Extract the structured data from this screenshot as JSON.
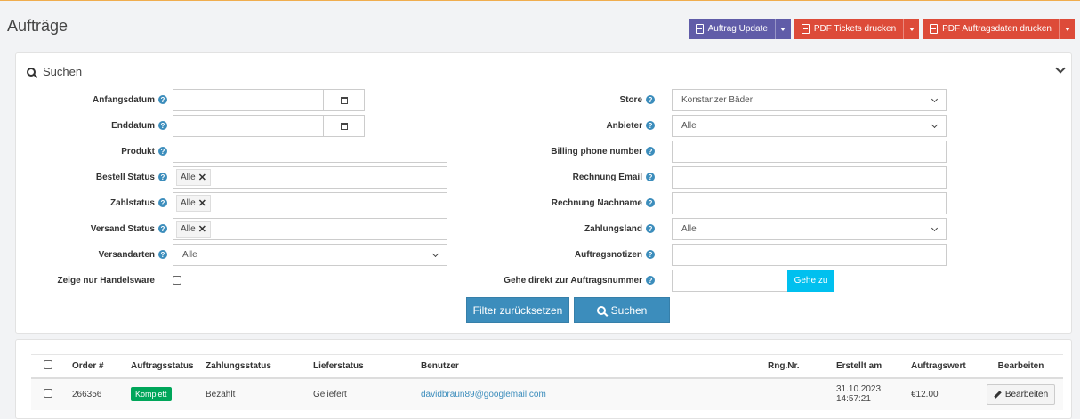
{
  "page": {
    "title": "Aufträge"
  },
  "toolbar": {
    "buttons": [
      {
        "label": "Auftrag Update",
        "icon": "pdf-icon",
        "color": "#605ca8"
      },
      {
        "label": "PDF Tickets drucken",
        "icon": "pdf-icon",
        "color": "#dd4b39"
      },
      {
        "label": "PDF Auftragsdaten drucken",
        "icon": "pdf-icon",
        "color": "#dd4b39"
      }
    ]
  },
  "search": {
    "title": "Suchen",
    "left_fields": [
      {
        "label": "Anfangsdatum",
        "value": ""
      },
      {
        "label": "Enddatum",
        "value": ""
      },
      {
        "label": "Produkt",
        "value": ""
      },
      {
        "label": "Bestell Status",
        "tag": "Alle"
      },
      {
        "label": "Zahlstatus",
        "tag": "Alle"
      },
      {
        "label": "Versand Status",
        "tag": "Alle"
      },
      {
        "label": "Versandarten",
        "value": "Alle"
      },
      {
        "label": "Zeige nur Handelsware"
      }
    ],
    "right_fields": [
      {
        "label": "Store",
        "value": "Konstanzer Bäder"
      },
      {
        "label": "Anbieter",
        "value": "Alle"
      },
      {
        "label": "Billing phone number",
        "value": ""
      },
      {
        "label": "Rechnung Email",
        "value": ""
      },
      {
        "label": "Rechnung Nachname",
        "value": ""
      },
      {
        "label": "Zahlungsland",
        "value": "Alle"
      },
      {
        "label": "Auftragsnotizen",
        "value": ""
      },
      {
        "label": "Gehe direkt zur Auftragsnummer",
        "value": ""
      }
    ],
    "goto_label": "Gehe zu",
    "reset_label": "Filter zurücksetzen",
    "search_label": "Suchen"
  },
  "table": {
    "columns": [
      "Order #",
      "Auftragsstatus",
      "Zahlungsstatus",
      "Lieferstatus",
      "Benutzer",
      "Rng.Nr.",
      "Erstellt am",
      "Auftragswert",
      "Bearbeiten"
    ],
    "rows": [
      {
        "order": "266356",
        "status": "Komplett",
        "payment": "Bezahlt",
        "delivery": "Geliefert",
        "user": "davidbraun89@googlemail.com",
        "invoice": "",
        "created_date": "31.10.2023",
        "created_time": "14:57:21",
        "value": "€12.00",
        "edit_label": "Bearbeiten"
      }
    ]
  },
  "colors": {
    "accent": "#3c8dbc",
    "success": "#00a65a",
    "danger": "#dd4b39",
    "purple": "#605ca8",
    "info": "#00c0ef"
  }
}
